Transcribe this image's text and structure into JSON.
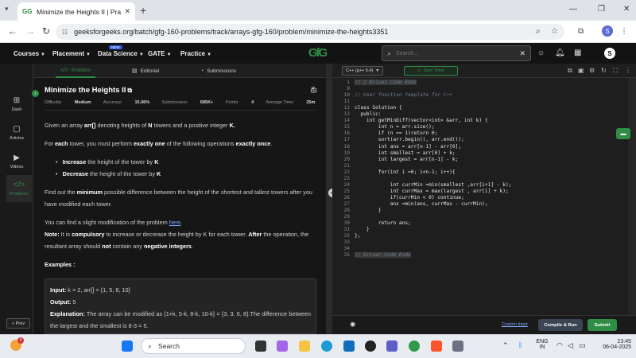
{
  "browser": {
    "tab_title": "Minimize the Heights II | Practic",
    "url": "geeksforgeeks.org/batch/gfg-160-problems/track/arrays-gfg-160/problem/minimize-the-heights3351",
    "profile_initial": "S"
  },
  "site_nav": {
    "items": [
      "Courses",
      "Placement",
      "Data Science",
      "GATE",
      "Practice"
    ],
    "new_badge": "NEW",
    "logo": "GfG",
    "search_placeholder": "Search...",
    "avatar_initial": "S"
  },
  "sidebar": {
    "items": [
      "Dash",
      "Articles",
      "Videos",
      "Problems"
    ],
    "prev_label": "« Prev"
  },
  "problem_tabs": [
    "Problem",
    "Editorial",
    "Submissions"
  ],
  "problem": {
    "title": "Minimize the Heights II",
    "meta": {
      "difficulty_label": "Difficulty:",
      "difficulty": "Medium",
      "accuracy_label": "Accuracy:",
      "accuracy": "15.06%",
      "submissions_label": "Submissions:",
      "submissions": "685K+",
      "points_label": "Points:",
      "points": "4",
      "time_label": "Average Time:",
      "time": "25m"
    },
    "intro_1": "Given an array ",
    "intro_arr": "arr[]",
    "intro_2": " denoting heights of ",
    "intro_n": "N",
    "intro_3": " towers and a positive integer ",
    "intro_k": "K.",
    "for_each_1": "For ",
    "for_each_b1": "each",
    "for_each_2": " tower, you must perform ",
    "for_each_b2": "exactly one",
    "for_each_3": " of the following operations ",
    "for_each_b3": "exactly once",
    "for_each_4": ".",
    "bullet_1_b": "Increase",
    "bullet_1": " the height of the tower by ",
    "bullet_1_k": "K",
    "bullet_2_b": "Decrease",
    "bullet_2": " the height of the tower by ",
    "bullet_2_k": "K",
    "find_1": "Find out the ",
    "find_b": "minimum",
    "find_2": " possible difference between the height of the shortest and tallest towers after you have modified each tower.",
    "mod_1": "You can find a slight modification of the problem ",
    "mod_link": "here",
    "mod_2": ".",
    "note_label": "Note:",
    "note_1": " It is ",
    "note_b1": "compulsory",
    "note_2": " to increase or decrease the height by K for each tower. ",
    "note_b2": "After",
    "note_3": " the operation, the resultant array should ",
    "note_b3": "not",
    "note_4": " contain any ",
    "note_b4": "negative integers",
    "note_5": ".",
    "examples_label": "Examples :",
    "example": {
      "input_label": "Input:",
      "input": " k = 2, arr[] = {1, 5, 8, 10}",
      "output_label": "Output:",
      "output": "  5",
      "explanation_label": "Explanation:",
      "explanation": " The array can be modified as {1+k, 5-k, 8-k, 10-k} = {3, 3, 6, 8}.The difference between the largest and the smallest is 8-3 = 5."
    }
  },
  "editor": {
    "language": "C++ (g++ 5.4)",
    "timer_label": "Start Timer",
    "line_numbers": [
      "1",
      "9",
      "10",
      "11",
      "12",
      "13",
      "14",
      "15",
      "16",
      "17",
      "18",
      "19",
      "20",
      "21",
      "22",
      "23",
      "24",
      "25",
      "26",
      "27",
      "28",
      "29",
      "30",
      "31",
      "32",
      "33",
      "34",
      "35"
    ],
    "code_lines": [
      "// } Driver Code Ends",
      "",
      "// User function template for C++",
      "",
      "class Solution {",
      "  public:",
      "    int getMinDiff(vector<int> &arr, int k) {",
      "        int n = arr.size();",
      "        if (n == 1)return 0;",
      "        sort(arr.begin(), arr.end());",
      "        int ans = arr[n-1] - arr[0];",
      "        int smallest = arr[0] + k;",
      "        int largest = arr[n-1] - k;",
      "",
      "        for(int i =0; i<n-1; i++){",
      "",
      "            int currMin =min(smallest ,arr[i+1] - k);",
      "            int currMax = max(largest , arr[i] + k);",
      "            if(currMin < 0) continue;",
      "            ans =min(ans, currMax - currMin);",
      "        }",
      "",
      "        return ans;",
      "    }",
      "};",
      "",
      "",
      "// Driver Code Ends"
    ],
    "custom_input": "Custom Input",
    "compile_label": "Compile & Run",
    "submit_label": "Submit"
  },
  "taskbar": {
    "search_label": "Search",
    "notification_count": "2",
    "language": "ENG",
    "region": "IN",
    "time": "23:45",
    "date": "06-04-2025"
  }
}
